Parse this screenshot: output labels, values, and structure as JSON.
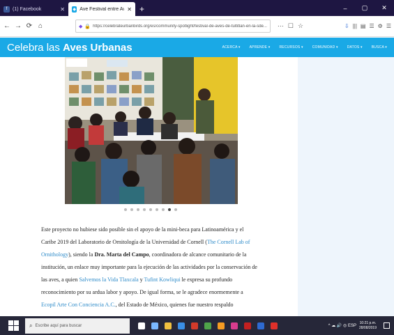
{
  "browser": {
    "tabs": [
      {
        "title": "(1) Facebook",
        "icon": "facebook-icon",
        "active": false
      },
      {
        "title": "Ave Festival entre Aves y Belleza",
        "icon": "ave-icon",
        "active": true
      }
    ],
    "new_tab_glyph": "+",
    "window_controls": {
      "minimize": "–",
      "maximize": "▢",
      "close": "✕"
    },
    "nav": {
      "back": "←",
      "forward": "→",
      "reload": "⟳",
      "home": "⌂"
    },
    "url": "https://celebrateurbanbirds.org/es/community-spotlight/festival-de-aves-de-tultitlan-en-la-sde...",
    "url_actions": [
      "⋯",
      "☐",
      "☆"
    ],
    "toolbar_icons": [
      "⇩",
      "|||",
      "▤",
      "☰",
      "⚙",
      "☰"
    ]
  },
  "site": {
    "logo_light": "Celebra las ",
    "logo_bold": "Aves Urbanas",
    "menu": [
      "ACERCA ▾",
      "APRENDE ▾",
      "RECURSOS ▾",
      "COMUNIDAD ▾",
      "DATOS ▾",
      "BUSCA ▾"
    ],
    "photo_alt": "Group of students and presenters seated at a table in front of bird posters",
    "carousel": {
      "count": 9,
      "active": 7
    }
  },
  "article": {
    "p1": "Este proyecto no hubiese sido posible sin el apoyo de la mini-beca para Latinoamérica y el Caribe 2019 del Laboratorio de Ornitología de la Universidad de Cornell (",
    "link1": "The Cornell Lab of Ornithology",
    "p2": "), siendo la ",
    "bold1": "Dra. Marta del Campo",
    "p3": ", coordinadora de alcance comunitario de la institución, un enlace muy importante para la ejecución de las actividades por la conservación de las aves, a quien ",
    "link2": "Salvemos la Vida Tlaxcala",
    "p4": " y ",
    "link3": "Tufint Kowliqui",
    "p5": " le expresa su profundo reconocimiento por su ardua labor y apoyo. De igual forma, se le agradece enormemente a ",
    "link4": "Ecopil Arte Con Conciencia A.C.",
    "p6": ", del Estado de México, quienes fue nuestro respaldo"
  },
  "taskbar": {
    "search_placeholder": "Escribe aquí para buscar",
    "apps": [
      "#ffffff",
      "#7ab8ff",
      "#f0c040",
      "#3a8ee6",
      "#d23a2a",
      "#4fa34a",
      "#f59b23",
      "#d93c8e",
      "#c42020",
      "#2e6ad1",
      "#e0302a"
    ],
    "tray_icons": "^ ☁ 🔊 ◎ ESP",
    "time": "10:21 p.m.",
    "date": "28/08/2019"
  },
  "colors": {
    "tabbar": "#1e1642",
    "header": "#1aa9e6",
    "link": "#2e8bc9",
    "sidebar": "#eef5fc",
    "taskbar": "#262739"
  }
}
